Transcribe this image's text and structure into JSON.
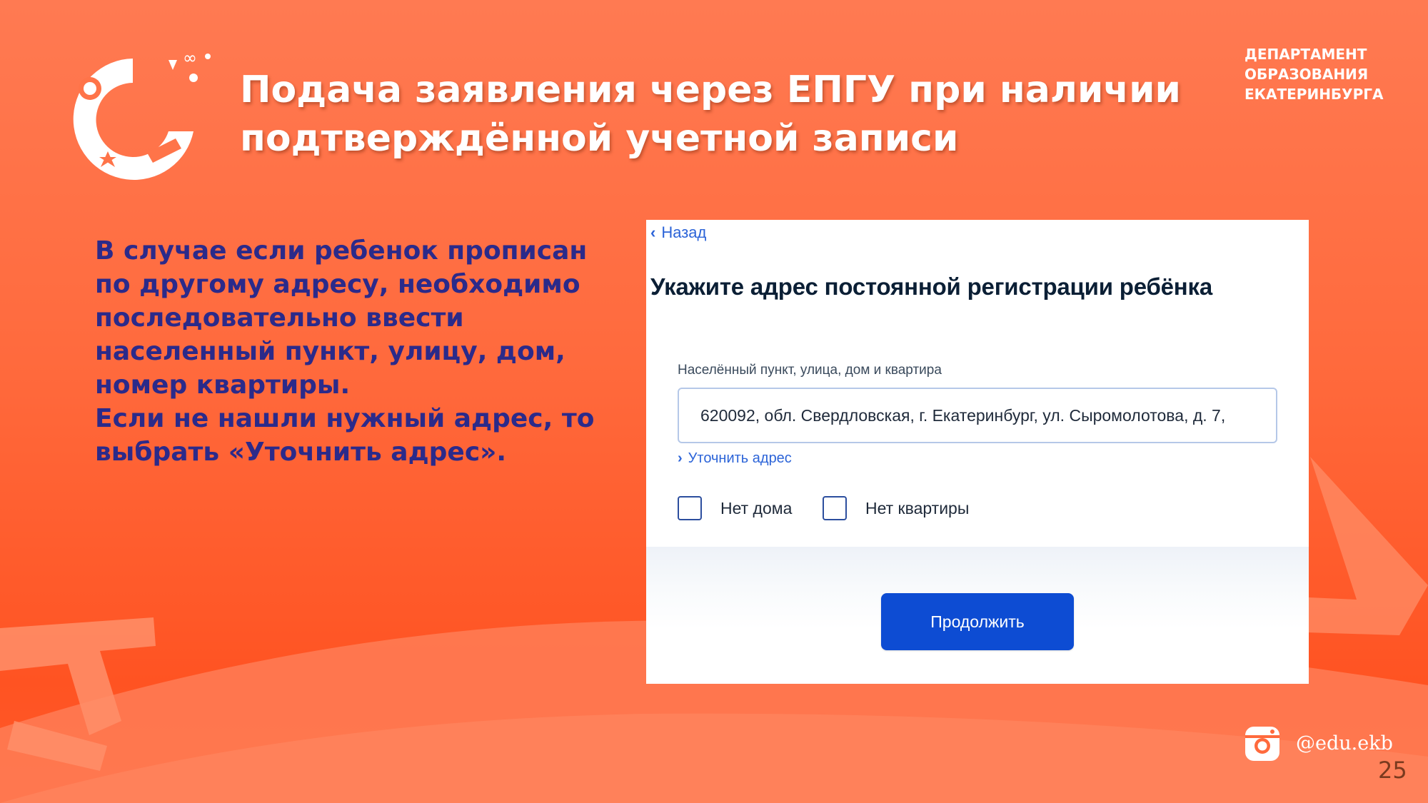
{
  "slide": {
    "title_lines": [
      "Подача заявления через ЕПГУ при наличии",
      "подтверждённой учетной записи"
    ],
    "department_lines": [
      "ДЕПАРТАМЕНТ",
      "ОБРАЗОВАНИЯ",
      "ЕКАТЕРИНБУРГА"
    ],
    "body_lines": [
      "В случае если ребенок прописан",
      "по другому адресу, необходимо",
      "последовательно ввести",
      "населенный пункт, улицу, дом,",
      "номер квартиры.",
      "Если не нашли нужный адрес, то",
      "выбрать «Уточнить адрес»."
    ],
    "social_handle": "@edu.ekb",
    "page_number": "25",
    "colors": {
      "background": "#ff6a3d",
      "body_text": "#2b2a8a",
      "title_text": "#ffffff"
    },
    "icons": {
      "logo": "city-festive-logo",
      "social": "instagram-icon"
    }
  },
  "screenshot": {
    "back_label": "Назад",
    "heading": "Укажите адрес постоянной регистрации ребёнка",
    "address_field": {
      "label": "Населённый пункт, улица, дом и квартира",
      "value": "620092, обл. Свердловская, г. Екатеринбург, ул. Сыромолотова, д. 7,"
    },
    "refine_link": "Уточнить адрес",
    "checkboxes": [
      {
        "label": "Нет дома",
        "checked": false
      },
      {
        "label": "Нет квартиры",
        "checked": false
      }
    ],
    "continue_button": "Продолжить",
    "colors": {
      "primary": "#0d4cd3",
      "link": "#2c64d8",
      "heading": "#0b1f35"
    }
  }
}
